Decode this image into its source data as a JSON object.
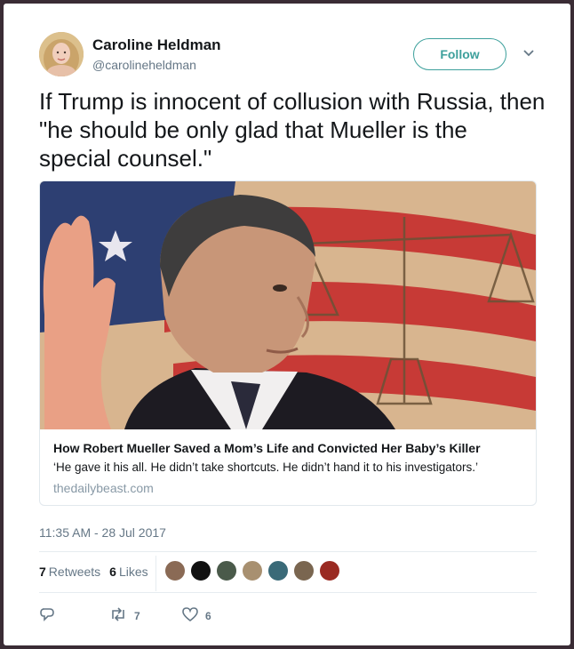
{
  "user": {
    "name": "Caroline Heldman",
    "handle": "@carolineheldman"
  },
  "follow_label": "Follow",
  "tweet": {
    "text": "If Trump is innocent of collusion with Russia, then \"he should be only glad that Mueller is the special counsel.\"",
    "timestamp": "11:35 AM - 28 Jul 2017"
  },
  "link_card": {
    "title": "How Robert Mueller Saved a Mom’s Life and Convicted Her Baby’s Killer",
    "description": "‘He gave it his all. He didn’t take shortcuts. He didn’t hand it to his investigators.’",
    "domain": "thedailybeast.com"
  },
  "stats": {
    "retweets_count": "7",
    "retweets_label": "Retweets",
    "likes_count": "6",
    "likes_label": "Likes"
  },
  "likers": [
    {
      "name": "liker-1",
      "color": "#8a6a55"
    },
    {
      "name": "liker-2",
      "color": "#111111"
    },
    {
      "name": "liker-3",
      "color": "#4a5a4a"
    },
    {
      "name": "liker-4",
      "color": "#a89070"
    },
    {
      "name": "liker-5",
      "color": "#3a6a78"
    },
    {
      "name": "liker-6",
      "color": "#7a6650"
    },
    {
      "name": "liker-7",
      "color": "#9a2a22"
    }
  ],
  "actions": {
    "reply_icon": "reply-icon",
    "retweet_count": "7",
    "like_count": "6"
  },
  "colors": {
    "follow_accent": "#3da09c",
    "secondary_text": "#657786",
    "border": "#e1e8ed"
  }
}
